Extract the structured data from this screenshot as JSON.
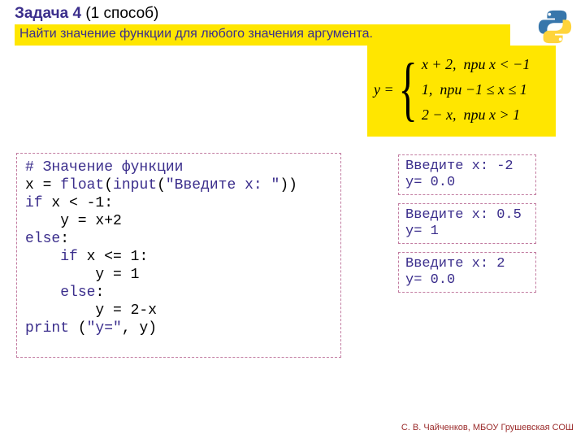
{
  "title_main": "Задача 4",
  "title_rest": " (1 способ)",
  "subtitle": "Найти значение функции для любого значения аргумента.",
  "formula": {
    "lhs": "y =",
    "rows": [
      {
        "expr": "x + 2,",
        "cond": "при x < −1"
      },
      {
        "expr": "1,",
        "cond": "при −1 ≤ x ≤ 1"
      },
      {
        "expr": "2 − x,",
        "cond": "при x > 1"
      }
    ]
  },
  "code": {
    "l1a": "# Значение функции",
    "l2a": "x = ",
    "l2b": "float",
    "l2c": "(",
    "l2d": "input",
    "l2e": "(",
    "l2f": "\"Введите x: \"",
    "l2g": "))",
    "l3a": "if",
    "l3b": " x < -1:",
    "l4a": "    y = x+2",
    "l5a": "else",
    "l5b": ":",
    "l6a": "    ",
    "l6b": "if",
    "l6c": " x <= 1:",
    "l7a": "        y = 1",
    "l8a": "    ",
    "l8b": "else",
    "l8c": ":",
    "l9a": "        y = 2-x",
    "l10a": "print",
    "l10b": " (",
    "l10c": "\"y=\"",
    "l10d": ", y)"
  },
  "outputs": {
    "o1": "Введите x: -2\ny= 0.0",
    "o2": "Введите x: 0.5\ny= 1",
    "o3": "Введите x: 2\ny= 0.0"
  },
  "footer": "С. В. Чайченков, МБОУ Грушевская СОШ"
}
